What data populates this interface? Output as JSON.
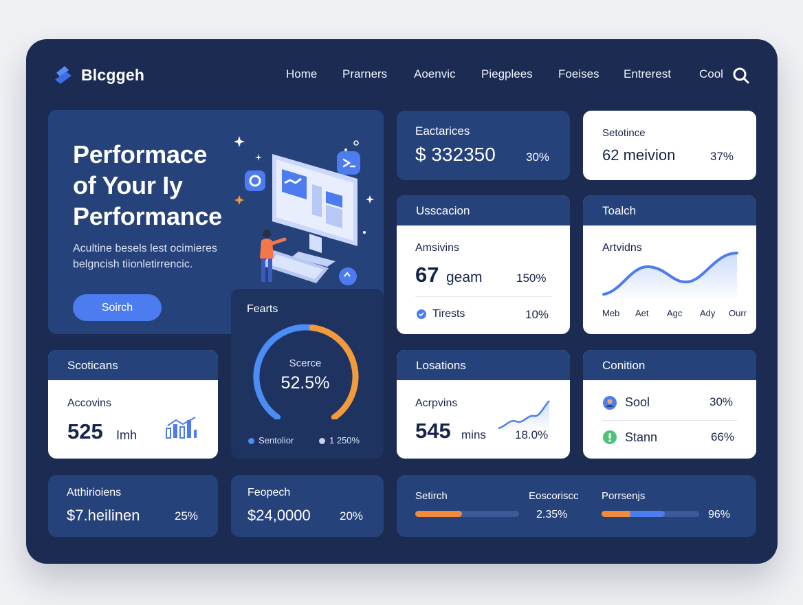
{
  "brand": {
    "name": "Blcggeh",
    "accent": "#4c7cf0"
  },
  "nav": {
    "items": [
      "Home",
      "Prarners",
      "Aoenvic",
      "Piegplees",
      "Foeises",
      "Entrerest",
      "Cool"
    ],
    "search_icon": "search-icon"
  },
  "hero": {
    "title_lines": [
      "Performace",
      "of Your Iy",
      "Performance"
    ],
    "desc_lines": [
      "Acultine besels lest ocimieres",
      "belgncish tiionletirrencic."
    ],
    "button": "Soirch",
    "illustration": "computer-illustration"
  },
  "stats_top": [
    {
      "label": "Eactarices",
      "value": "$ 332350",
      "pct": "30%"
    },
    {
      "label": "Setotince",
      "value": "62 meivion",
      "pct": "37%"
    }
  ],
  "usscacion": {
    "title": "Usscacion",
    "label": "Amsivins",
    "value": "67",
    "unit": "geam",
    "pct": "150%",
    "footer_label": "Tirests",
    "footer_pct": "10%",
    "footer_icon": "check-circle-icon"
  },
  "toalch": {
    "title": "Toalch",
    "label": "Artvidns",
    "x_labels": [
      "Meb",
      "Aet",
      "Agc",
      "Ady",
      "Ourr"
    ]
  },
  "scores": {
    "title": "Fearts",
    "center_label": "Scerce",
    "center_value": "52.5%",
    "value_fraction": 0.525,
    "legend": [
      {
        "label": "Sentolior",
        "color": "#4c8cf5"
      },
      {
        "label": "1 250%",
        "color": "#c7d2ea"
      }
    ],
    "colors": [
      "#4c8cf5",
      "#f39a3c"
    ]
  },
  "scoticans": {
    "title": "Scoticans",
    "label": "Accovins",
    "value": "525",
    "unit": "Imh",
    "icon": "bar-chart-icon"
  },
  "losations": {
    "title": "Losations",
    "label": "Acrpvins",
    "value": "545",
    "unit": "mins",
    "pct": "18.0%"
  },
  "condition": {
    "title": "Conition",
    "rows": [
      {
        "label": "Sool",
        "pct": "30%",
        "icon": "user-icon",
        "color": "#4c7cf0"
      },
      {
        "label": "Stann",
        "pct": "66%",
        "icon": "alert-icon",
        "color": "#4cc27a"
      }
    ]
  },
  "bottom": [
    {
      "label": "Atthirioiens",
      "value": "$7.heilinen",
      "pct": "25%"
    },
    {
      "label": "Feopech",
      "value": "$24,0000",
      "pct": "20%"
    }
  ],
  "progress": {
    "items": [
      {
        "label": "Setirch",
        "fraction": 0.45,
        "colors": [
          "#f38a3a"
        ]
      },
      {
        "label": "Eoscoriscc",
        "pct": "2.35%"
      },
      {
        "label": "Porrsenjs",
        "fraction": 0.65,
        "colors": [
          "#f38a3a",
          "#4c7cf0"
        ],
        "pct": "96%"
      }
    ]
  }
}
